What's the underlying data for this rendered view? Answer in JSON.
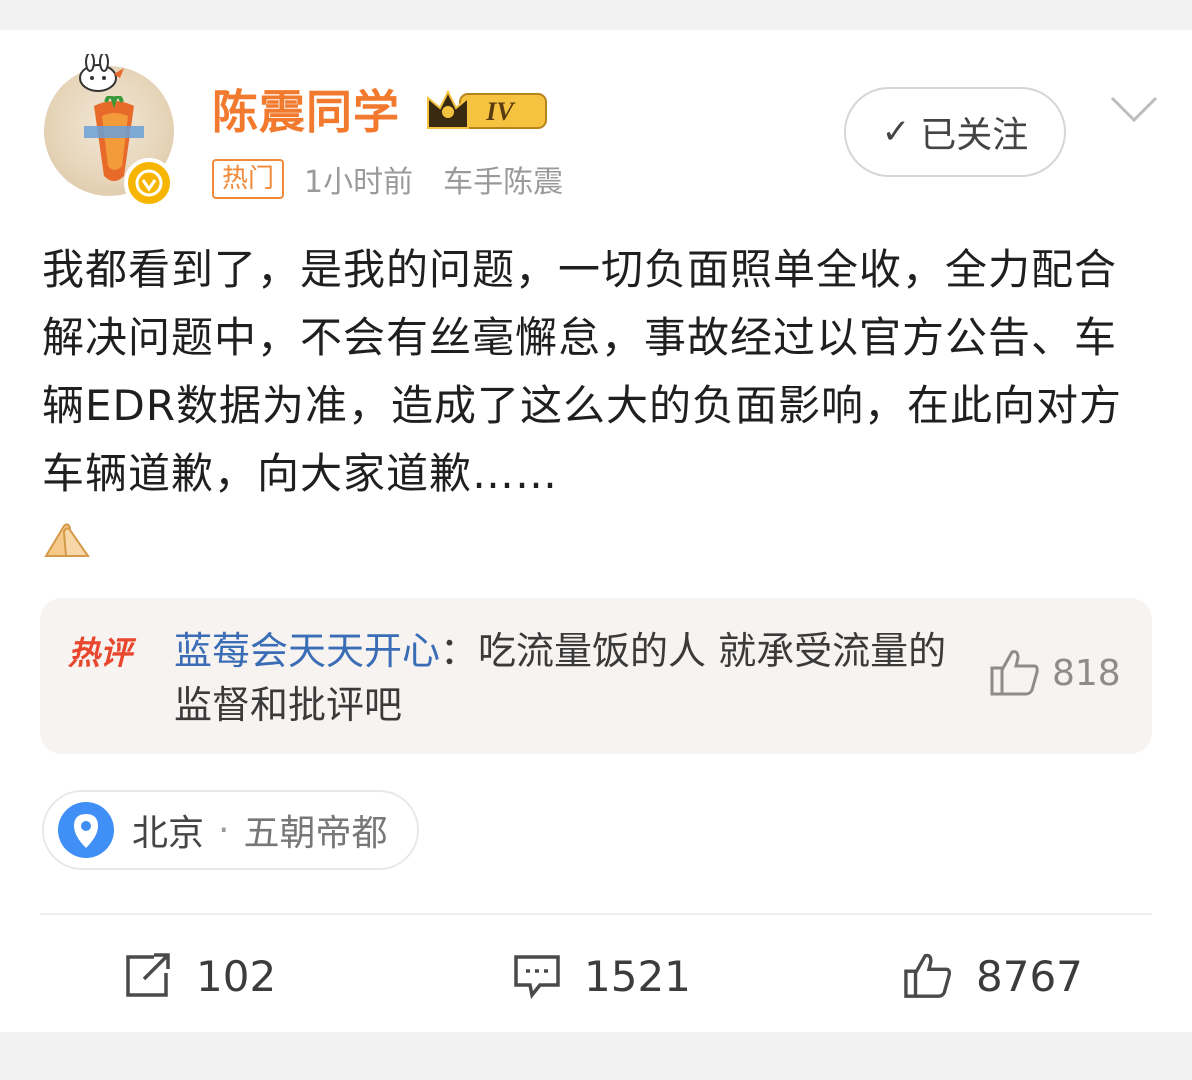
{
  "user": {
    "name": "陈震同学",
    "vip_level": "IV",
    "hot_tag": "热门",
    "time": "1小时前",
    "source": "车手陈震"
  },
  "follow_button": {
    "label": "已关注"
  },
  "post": {
    "text": "我都看到了，是我的问题，一切负面照单全收，全力配合解决问题中，不会有丝毫懈怠，事故经过以官方公告、车辆EDR数据为准，造成了这么大的负面影响，在此向对方车辆道歉，向大家道歉……"
  },
  "hot_comment": {
    "tag": "热评",
    "user": "蓝莓会天天开心",
    "separator": "：",
    "text": "吃流量饭的人 就承受流量的监督和批评吧",
    "likes": "818"
  },
  "location": {
    "city": "北京",
    "separator": "·",
    "place": "五朝帝都"
  },
  "actions": {
    "reposts": "102",
    "comments": "1521",
    "likes": "8767"
  },
  "icons": {
    "more": "chevron-down-icon",
    "repost": "share-icon",
    "comment": "comment-icon",
    "like": "thumbs-up-icon",
    "location": "location-pin-icon"
  },
  "colors": {
    "username": "#f27a2f",
    "hot_comment_user": "#3a6db5",
    "hot_comment_tag": "#e8472d",
    "location_pin": "#3f8ff7"
  }
}
